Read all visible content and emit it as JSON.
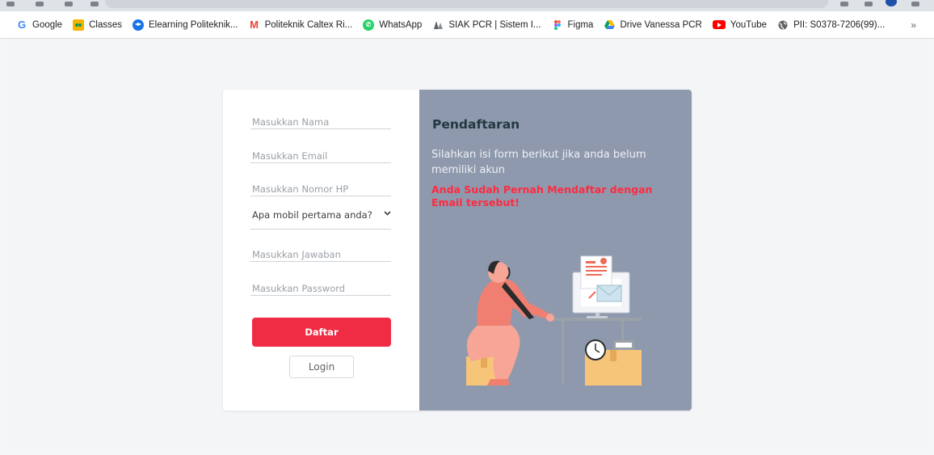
{
  "bookmarks": [
    {
      "label": "Google",
      "icon": "google-icon",
      "color": "#4285f4"
    },
    {
      "label": "Classes",
      "icon": "classes-icon",
      "color": "#f4b400"
    },
    {
      "label": "Elearning Politeknik...",
      "icon": "elearning-icon",
      "color": "#1a73e8"
    },
    {
      "label": "Politeknik Caltex Ri...",
      "icon": "gmail-icon",
      "color": "#ea4335"
    },
    {
      "label": "WhatsApp",
      "icon": "whatsapp-icon",
      "color": "#25d366"
    },
    {
      "label": "SIAK PCR | Sistem I...",
      "icon": "siak-icon",
      "color": "#5f6368"
    },
    {
      "label": "Figma",
      "icon": "figma-icon",
      "color": "#f24e1e"
    },
    {
      "label": "Drive Vanessa PCR",
      "icon": "drive-icon",
      "color": "#0f9d58"
    },
    {
      "label": "YouTube",
      "icon": "youtube-icon",
      "color": "#ff0000"
    },
    {
      "label": "PII: S0378-7206(99)...",
      "icon": "globe-icon",
      "color": "#5f6368"
    }
  ],
  "bookmarks_more": "»",
  "form": {
    "nama_placeholder": "Masukkan Nama",
    "email_placeholder": "Masukkan Email",
    "hp_placeholder": "Masukkan Nomor HP",
    "security_question": "Apa mobil pertama anda?",
    "jawaban_placeholder": "Masukkan Jawaban",
    "password_placeholder": "Masukkan Password",
    "daftar_label": "Daftar",
    "login_label": "Login"
  },
  "info": {
    "title": "Pendaftaran",
    "description": "Silahkan isi form berikut jika anda belum memiliki akun",
    "error": "Anda Sudah Pernah Mendaftar dengan Email tersebut!"
  },
  "colors": {
    "accent": "#ef2c43",
    "panel": "#8e99ad",
    "error": "#ff2a40",
    "title": "#23383f"
  }
}
